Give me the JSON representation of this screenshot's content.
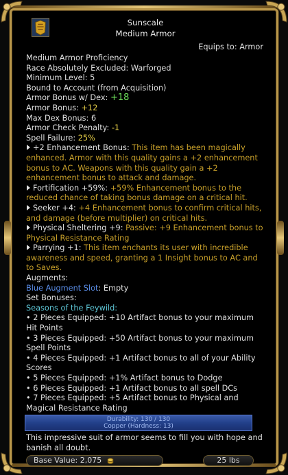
{
  "item": {
    "name": "Sunscale",
    "type": "Medium Armor",
    "equips_label": "Equips to:",
    "equips_value": "Armor"
  },
  "props": {
    "proficiency": "Medium Armor Proficiency",
    "race_label": "Race Absolutely Excluded:",
    "race_value": "Warforged",
    "minlevel_label": "Minimum Level:",
    "minlevel_value": "5",
    "bound": "Bound to Account (from Acquisition)",
    "ab_dex_label": "Armor Bonus w/ Dex:",
    "ab_dex_value": "+18",
    "ab_label": "Armor Bonus:",
    "ab_value": "+12",
    "maxdex_label": "Max Dex Bonus:",
    "maxdex_value": "6",
    "acp_label": "Armor Check Penalty:",
    "acp_value": "-1",
    "spellfail_label": "Spell Failure:",
    "spellfail_value": "25%"
  },
  "enhancements": [
    {
      "name": "+2 Enhancement Bonus:",
      "desc": "This item has been magically enhanced. Armor with this quality gains a +2 enhancement bonus to AC. Weapons with this quality gain a +2 enhancement bonus to attack and damage."
    },
    {
      "name": "Fortification +59%:",
      "desc": "+59% Enhancement bonus to the reduced chance of taking bonus damage on a critical hit."
    },
    {
      "name": "Seeker +4:",
      "desc": "+4 Enhancement bonus to confirm critical hits, and damage (before multiplier) on critical hits."
    },
    {
      "name": "Physical Sheltering +9:",
      "desc": "Passive: +9 Enhancement bonus to Physical Resistance Rating"
    },
    {
      "name": "Parrying +1:",
      "desc": "This item enchants its user with incredible awareness and speed, granting a 1 Insight bonus to AC and to Saves."
    }
  ],
  "augments": {
    "label": "Augments:",
    "slot_label": "Blue Augment Slot",
    "slot_value": ": Empty"
  },
  "set": {
    "label": "Set Bonuses:",
    "name": "Seasons of the Feywild:",
    "items": [
      "• 2 Pieces Equipped: +10 Artifact bonus to your maximum Hit Points",
      "• 3 Pieces Equipped: +50 Artifact bonus to your maximum Spell Points",
      "• 4 Pieces Equipped: +1 Artifact bonus to all of your Ability Scores",
      "• 5 Pieces Equipped: +1% Artifact bonus to Dodge",
      "• 6 Pieces Equipped: +1 Artifact bonus to all spell DCs",
      "• 7 Pieces Equipped: +5 Artifact bonus to Physical and Magical Resistance Rating"
    ]
  },
  "durability": {
    "line1": "Durability: 130 / 130",
    "line2": "Copper (Hardness: 13)",
    "fraction": 1.0
  },
  "flavor": "This impressive suit of armor seems to fill you with hope and banish all doubt.",
  "footer": {
    "base_value_label": "Base Value:",
    "base_value": "2,075",
    "weight": "25 lbs"
  },
  "colors": {
    "gold_border": "#b8964a",
    "enhancement_desc": "#c8a02a",
    "green_value": "#6ee05a",
    "yellow_value": "#e8d048",
    "augment_blue": "#5a8de8",
    "set_cyan": "#5fc8d8",
    "durability_bar": "#22408a"
  },
  "icons": [
    "item-armor-icon",
    "coin-icon",
    "bullet-triangle-icon"
  ]
}
